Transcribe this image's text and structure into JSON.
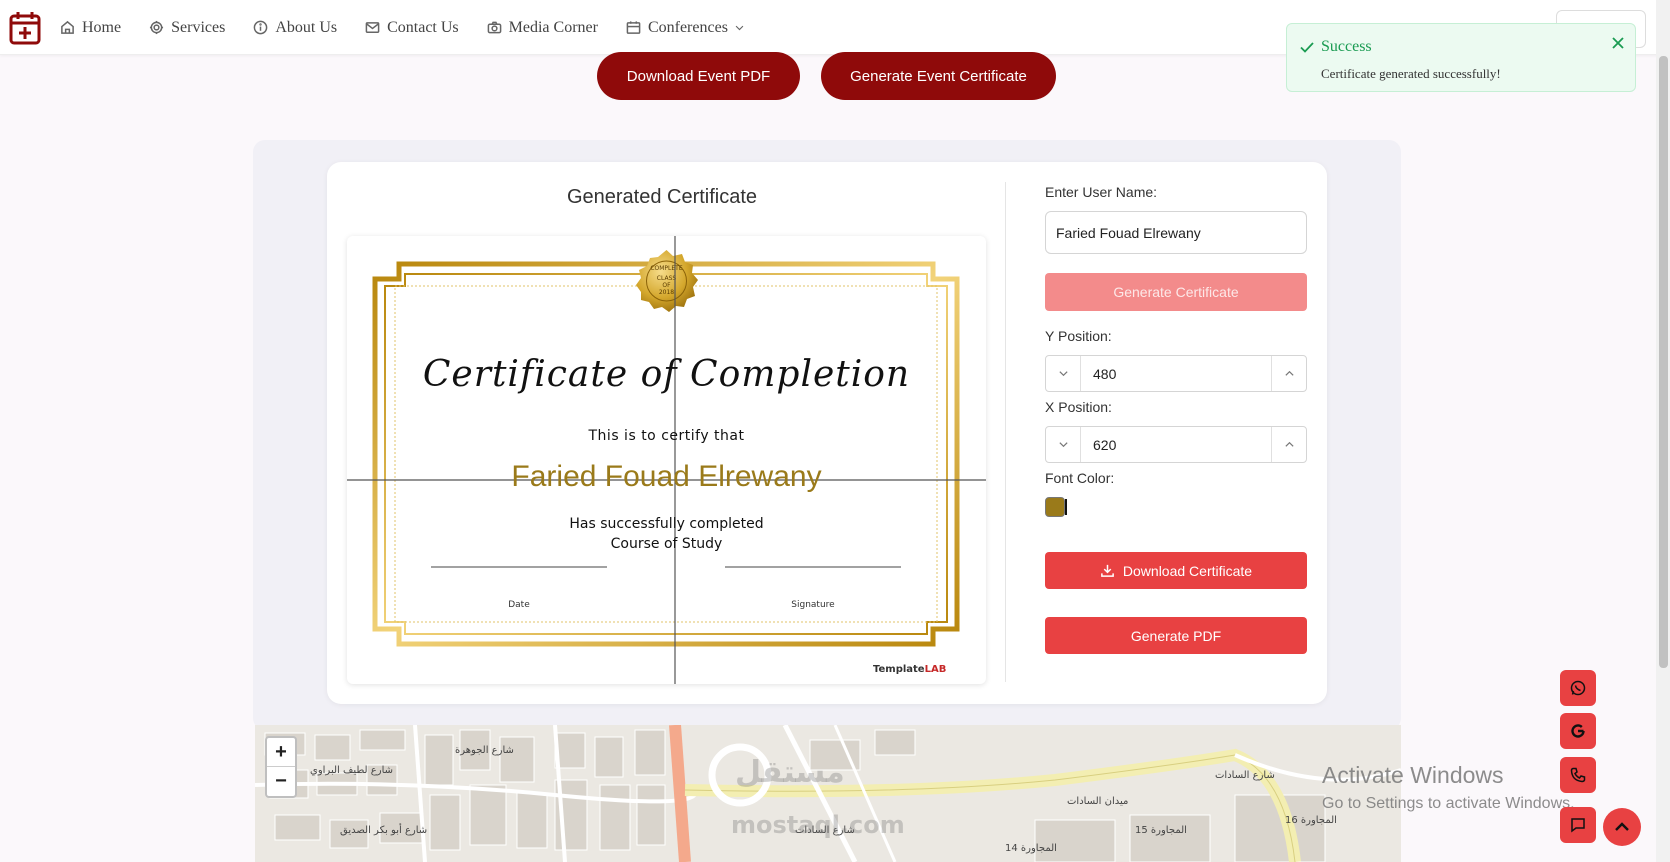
{
  "nav": {
    "items": [
      {
        "label": "Home",
        "icon": "home-icon"
      },
      {
        "label": "Services",
        "icon": "gear-icon"
      },
      {
        "label": "About Us",
        "icon": "info-icon"
      },
      {
        "label": "Contact Us",
        "icon": "mail-icon"
      },
      {
        "label": "Media Corner",
        "icon": "camera-icon"
      },
      {
        "label": "Conferences",
        "icon": "calendar-icon"
      }
    ]
  },
  "actions": {
    "download_event_pdf": "Download Event PDF",
    "generate_event_certificate": "Generate Event Certificate"
  },
  "toast": {
    "title": "Success",
    "message": "Certificate generated successfully!"
  },
  "certificate": {
    "panel_title": "Generated Certificate",
    "heading": "Certificate of Completion",
    "certify_text": "This is to certify that",
    "name": "Faried Fouad Elrewany",
    "completed_text": "Has successfully completed",
    "course_text": "Course of Study",
    "date_label": "Date",
    "signature_label": "Signature",
    "brand_prefix": "Template",
    "brand_suffix": "LAB",
    "seal": {
      "line1": "COMPLETE",
      "line2": "CLASS",
      "line3": "OF",
      "line4": "2018"
    }
  },
  "form": {
    "user_name_label": "Enter User Name:",
    "user_name_value": "Faried Fouad Elrewany",
    "generate_certificate": "Generate Certificate",
    "y_label": "Y Position:",
    "y_value": "480",
    "x_label": "X Position:",
    "x_value": "620",
    "font_color_label": "Font Color:",
    "font_color": "#9a7a1a",
    "download_certificate": "Download Certificate",
    "generate_pdf": "Generate PDF"
  },
  "map": {
    "zoom_in": "+",
    "zoom_out": "−",
    "labels": [
      "شارع السادات",
      "ميدان السادات",
      "شارع السادات",
      "المجاورة 14",
      "المجاورة 15",
      "المجاورة 16",
      "شارع الجوهرة",
      "شارع لطيف البراوي",
      "شارع أبو بكر الصديق",
      "مستقل",
      "mostaql.com"
    ]
  },
  "watermark": {
    "title": "Activate Windows",
    "subtitle": "Go to Settings to activate Windows."
  },
  "colors": {
    "brand_dark_red": "#8f0a0a",
    "accent_red": "#e84142",
    "success_green": "#1a9b52"
  },
  "floating": [
    "whatsapp-icon",
    "google-icon",
    "phone-icon",
    "chat-icon"
  ]
}
